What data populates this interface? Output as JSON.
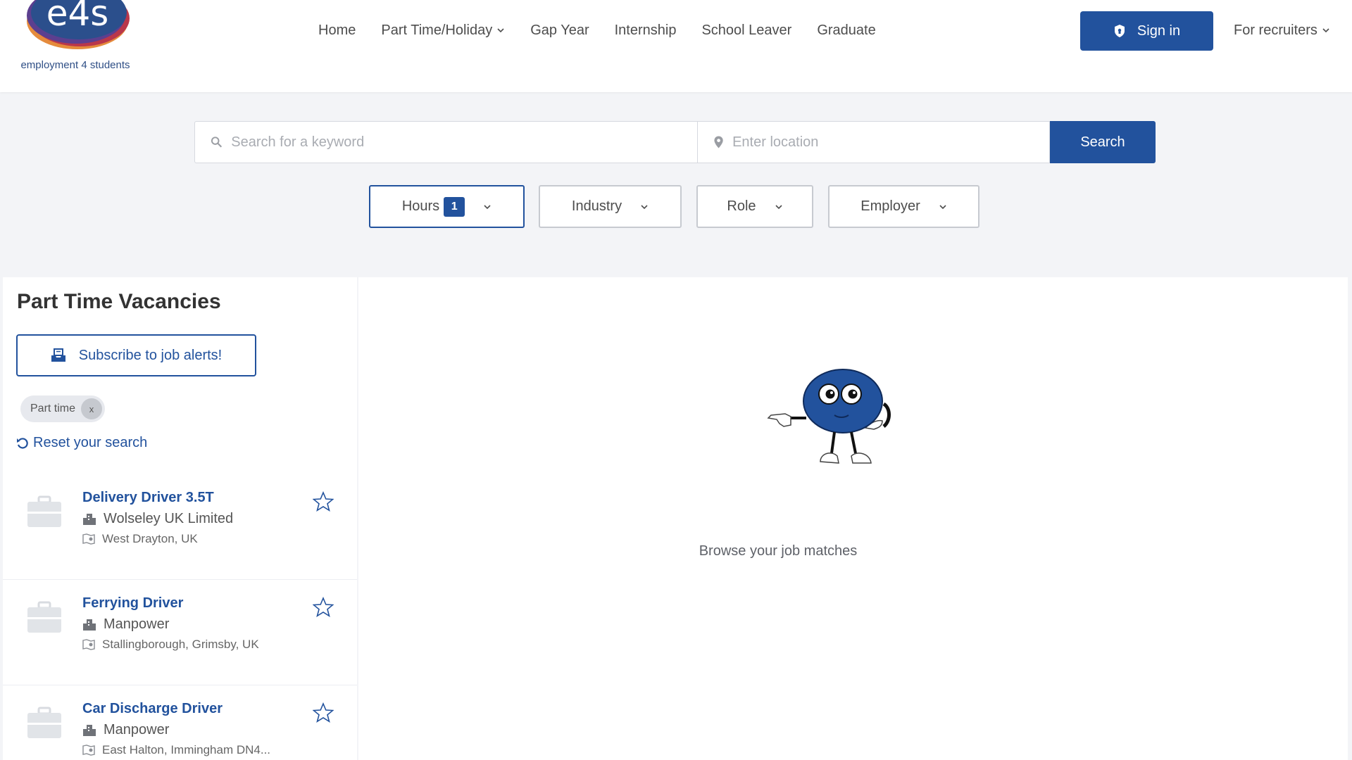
{
  "header": {
    "logo_mark": "e4s",
    "logo_text": "employment 4 students",
    "nav": [
      {
        "label": "Home",
        "has_dropdown": false
      },
      {
        "label": "Part Time/Holiday",
        "has_dropdown": true
      },
      {
        "label": "Gap Year",
        "has_dropdown": false
      },
      {
        "label": "Internship",
        "has_dropdown": false
      },
      {
        "label": "School Leaver",
        "has_dropdown": false
      },
      {
        "label": "Graduate",
        "has_dropdown": false
      }
    ],
    "signin_label": "Sign in",
    "recruiters_label": "For recruiters"
  },
  "search": {
    "keyword_placeholder": "Search for a keyword",
    "keyword_value": "",
    "location_placeholder": "Enter location",
    "location_value": "",
    "button_label": "Search"
  },
  "filters": [
    {
      "label": "Hours",
      "count": "1"
    },
    {
      "label": "Industry"
    },
    {
      "label": "Role"
    },
    {
      "label": "Employer"
    }
  ],
  "left": {
    "title": "Part Time Vacancies",
    "subscribe_label": "Subscribe to job alerts!",
    "chip_label": "Part time",
    "chip_close": "x",
    "reset_label": "Reset your search"
  },
  "jobs": [
    {
      "title": "Delivery Driver 3.5T",
      "company": "Wolseley UK Limited",
      "location": "West Drayton, UK"
    },
    {
      "title": "Ferrying Driver",
      "company": "Manpower",
      "location": "Stallingborough, Grimsby, UK"
    },
    {
      "title": "Car Discharge Driver",
      "company": "Manpower",
      "location": "East Halton, Immingham DN4..."
    }
  ],
  "right": {
    "browse_label": "Browse your job matches"
  },
  "colors": {
    "brand_blue": "#22529d",
    "page_bg": "#f3f4f7"
  },
  "icons": [
    "search-icon",
    "location-pin-icon",
    "shield-icon",
    "chevron-down-icon",
    "inbox-icon",
    "reset-icon",
    "briefcase-icon",
    "building-icon",
    "map-icon",
    "star-icon"
  ]
}
